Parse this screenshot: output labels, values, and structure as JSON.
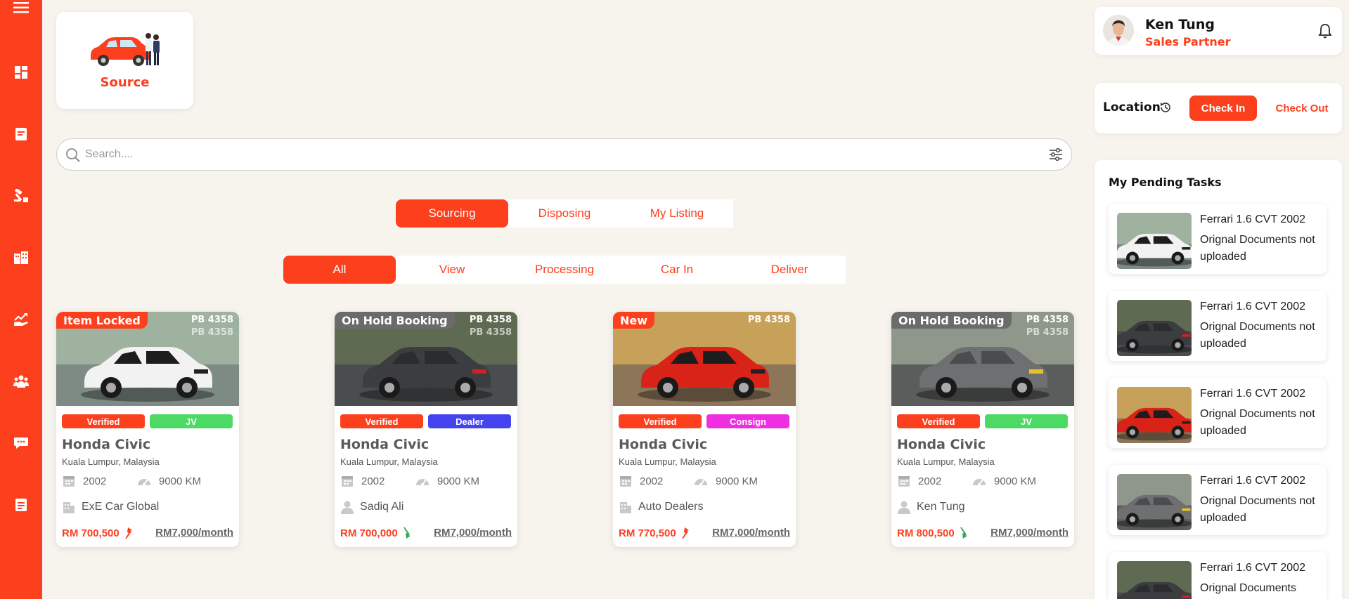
{
  "sidebar": {
    "items": [
      {
        "icon": "menu-icon"
      },
      {
        "icon": "dashboard-icon"
      },
      {
        "icon": "document-icon"
      },
      {
        "icon": "auction-icon"
      },
      {
        "icon": "building-icon"
      },
      {
        "icon": "chart-hand-icon"
      },
      {
        "icon": "team-icon"
      },
      {
        "icon": "chat-icon"
      },
      {
        "icon": "report-icon"
      }
    ]
  },
  "source": {
    "label": "Source"
  },
  "search": {
    "placeholder": "Search...."
  },
  "tabs": [
    {
      "label": "Sourcing",
      "active": true
    },
    {
      "label": "Disposing",
      "active": false
    },
    {
      "label": "My Listing",
      "active": false
    }
  ],
  "filters": [
    {
      "label": "All",
      "active": true
    },
    {
      "label": "View",
      "active": false
    },
    {
      "label": "Processing",
      "active": false
    },
    {
      "label": "Car In",
      "active": false
    },
    {
      "label": "Deliver",
      "active": false
    }
  ],
  "cars": [
    {
      "status": "Item Locked",
      "status_color": "#fc3f1d",
      "plate": "PB 4358",
      "plate2": "PB 4358",
      "badges": [
        {
          "label": "Verified",
          "color": "#fc3f1d"
        },
        {
          "label": "JV",
          "color": "#4cd964"
        }
      ],
      "name": "Honda Civic",
      "location": "Kuala Lumpur, Malaysia",
      "year": "2002",
      "mileage": "9000 KM",
      "owner": "ExE Car Global",
      "owner_icon": "building-icon",
      "price": "RM 700,500",
      "trend": "up",
      "monthly": "RM7,000/month",
      "photo": "white-suv"
    },
    {
      "status": "On Hold Booking",
      "status_color": "#6b6b6b",
      "plate": "PB 4358",
      "plate2": "PB 4358",
      "badges": [
        {
          "label": "Verified",
          "color": "#fc3f1d"
        },
        {
          "label": "Dealer",
          "color": "#4444ee"
        }
      ],
      "name": "Honda Civic",
      "location": "Kuala Lumpur, Malaysia",
      "year": "2002",
      "mileage": "9000 KM",
      "owner": "Sadiq Ali",
      "owner_icon": "person-icon",
      "price": "RM 700,000",
      "trend": "down",
      "monthly": "RM7,000/month",
      "photo": "dark-hatch"
    },
    {
      "status": "New",
      "status_color": "#fc3f1d",
      "plate": "PB 4358",
      "plate2": "",
      "badges": [
        {
          "label": "Verified",
          "color": "#fc3f1d"
        },
        {
          "label": "Consign",
          "color": "#ee2ee0"
        }
      ],
      "name": "Honda Civic",
      "location": "Kuala Lumpur, Malaysia",
      "year": "2002",
      "mileage": "9000 KM",
      "owner": "Auto Dealers",
      "owner_icon": "building-icon",
      "price": "RM 770,500",
      "trend": "up",
      "monthly": "RM7,000/month",
      "photo": "red-suv"
    },
    {
      "status": "On Hold Booking",
      "status_color": "#6b6b6b",
      "plate": "PB 4358",
      "plate2": "PB 4358",
      "badges": [
        {
          "label": "Verified",
          "color": "#fc3f1d"
        },
        {
          "label": "JV",
          "color": "#4cd964"
        }
      ],
      "name": "Honda Civic",
      "location": "Kuala Lumpur, Malaysia",
      "year": "2002",
      "mileage": "9000 KM",
      "owner": "Ken Tung",
      "owner_icon": "person-icon",
      "price": "RM 800,500",
      "trend": "down",
      "monthly": "RM7,000/month",
      "photo": "grey-coupe"
    }
  ],
  "profile": {
    "name": "Ken Tung",
    "role": "Sales Partner"
  },
  "location": {
    "label": "Location",
    "check_in": "Check In",
    "check_out": "Check Out"
  },
  "tasks": {
    "title": "My Pending Tasks",
    "items": [
      {
        "title": "Ferrari 1.6 CVT 2002",
        "desc": "Orignal Documents not uploaded",
        "photo": "white-suv"
      },
      {
        "title": "Ferrari 1.6 CVT 2002",
        "desc": "Orignal Documents not uploaded",
        "photo": "dark-hatch"
      },
      {
        "title": "Ferrari 1.6 CVT 2002",
        "desc": "Orignal Documents not uploaded",
        "photo": "red-suv"
      },
      {
        "title": "Ferrari 1.6 CVT 2002",
        "desc": "Orignal Documents not uploaded",
        "photo": "grey-coupe"
      },
      {
        "title": "Ferrari 1.6 CVT 2002",
        "desc": "Orignal Documents",
        "photo": "dark-hatch"
      }
    ]
  },
  "colors": {
    "accent": "#fc3f1d",
    "background": "#f7f4ee"
  }
}
